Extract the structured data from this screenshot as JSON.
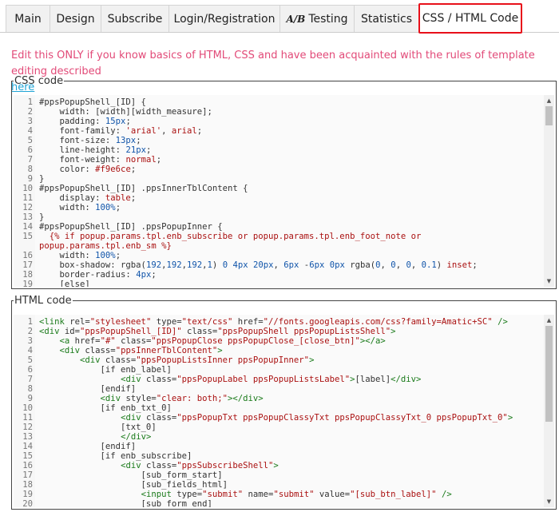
{
  "tabs": [
    {
      "label": "Main"
    },
    {
      "label": "Design"
    },
    {
      "label": "Subscribe"
    },
    {
      "label": "Login/Registration"
    },
    {
      "label": "Testing",
      "icon": "ab-icon",
      "icon_text": "A/B"
    },
    {
      "label": "Statistics"
    },
    {
      "label": "CSS / HTML Code",
      "active": true
    }
  ],
  "notice": {
    "text": "Edit this ONLY if you know basics of HTML, CSS and have been acquainted with the rules of template editing described",
    "link": "here"
  },
  "css_panel": {
    "title": "CSS code",
    "lines": [
      "#ppsPopupShell_[ID] {",
      "    width: [width][width_measure];",
      "    padding: 15px;",
      "    font-family: 'arial', arial;",
      "    font-size: 13px;",
      "    line-height: 21px;",
      "    font-weight: normal;",
      "    color: #f9e6ce;",
      "}",
      "#ppsPopupShell_[ID] .ppsInnerTblContent {",
      "    display: table;",
      "    width: 100%;",
      "}",
      "#ppsPopupShell_[ID] .ppsPopupInner {",
      "  {% if popup.params.tpl.enb_subscribe or popup.params.tpl.enb_foot_note or",
      "popup.params.tpl.enb_sm %}",
      "    width: 100%;",
      "    box-shadow: rgba(192,192,192,1) 0 4px 20px, 6px -6px 0px rgba(0, 0, 0, 0.1) inset;",
      "    border-radius: 4px;",
      "    [else]"
    ],
    "line_numbers": [
      "1",
      "2",
      "3",
      "4",
      "5",
      "6",
      "7",
      "8",
      "9",
      "10",
      "11",
      "12",
      "13",
      "14",
      "15",
      "",
      "16",
      "17",
      "18",
      "19"
    ]
  },
  "html_panel": {
    "title": "HTML code",
    "lines": [
      "<link rel=\"stylesheet\" type=\"text/css\" href=\"//fonts.googleapis.com/css?family=Amatic+SC\" />",
      "<div id=\"ppsPopupShell_[ID]\" class=\"ppsPopupShell ppsPopupListsShell\">",
      "    <a href=\"#\" class=\"ppsPopupClose ppsPopupClose_[close_btn]\"></a>",
      "    <div class=\"ppsInnerTblContent\">",
      "        <div class=\"ppsPopupListsInner ppsPopupInner\">",
      "            [if enb_label]",
      "                <div class=\"ppsPopupLabel ppsPopupListsLabel\">[label]</div>",
      "            [endif]",
      "            <div style=\"clear: both;\"></div>",
      "            [if enb_txt_0]",
      "                <div class=\"ppsPopupTxt ppsPopupClassyTxt ppsPopupClassyTxt_0 ppsPopupTxt_0\">",
      "                [txt_0]",
      "                </div>",
      "            [endif]",
      "            [if enb_subscribe]",
      "                <div class=\"ppsSubscribeShell\">",
      "                    [sub_form_start]",
      "                    [sub_fields_html]",
      "                    <input type=\"submit\" name=\"submit\" value=\"[sub_btn_label]\" />",
      "                    [sub_form_end]"
    ],
    "line_numbers": [
      "1",
      "2",
      "3",
      "4",
      "5",
      "6",
      "7",
      "8",
      "9",
      "10",
      "11",
      "12",
      "13",
      "14",
      "15",
      "16",
      "17",
      "18",
      "19",
      "20"
    ]
  }
}
